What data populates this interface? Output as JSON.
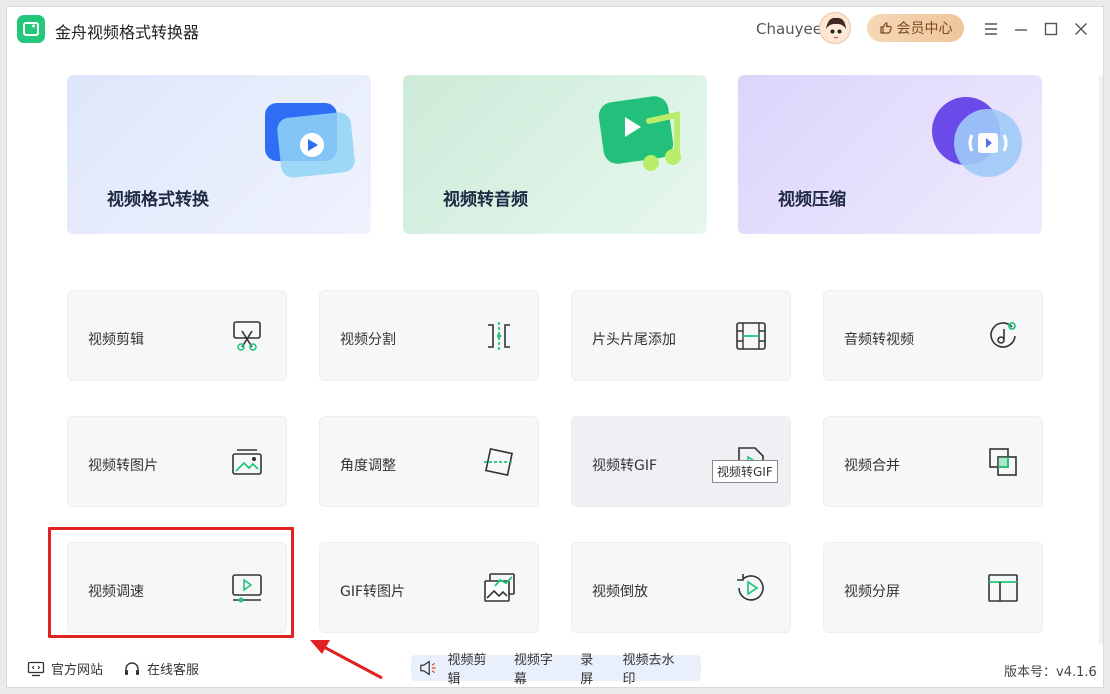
{
  "app": {
    "title": "金舟视频格式转换器"
  },
  "header": {
    "username": "Chauyee",
    "vip_label": "会员中心"
  },
  "hero": [
    {
      "label": "视频格式转换"
    },
    {
      "label": "视频转音频"
    },
    {
      "label": "视频压缩"
    }
  ],
  "tools": [
    {
      "label": "视频剪辑",
      "icon": "scissors-screen-icon"
    },
    {
      "label": "视频分割",
      "icon": "split-icon"
    },
    {
      "label": "片头片尾添加",
      "icon": "film-strip-icon"
    },
    {
      "label": "音频转视频",
      "icon": "music-note-circle-icon"
    },
    {
      "label": "视频转图片",
      "icon": "image-icon"
    },
    {
      "label": "角度调整",
      "icon": "rotate-frame-icon"
    },
    {
      "label": "视频转GIF",
      "icon": "gif-file-icon"
    },
    {
      "label": "视频合并",
      "icon": "merge-squares-icon"
    },
    {
      "label": "视频调速",
      "icon": "speed-monitor-icon"
    },
    {
      "label": "GIF转图片",
      "icon": "gallery-icon"
    },
    {
      "label": "视频倒放",
      "icon": "reverse-play-icon"
    },
    {
      "label": "视频分屏",
      "icon": "split-screen-icon"
    }
  ],
  "tooltip": "视频转GIF",
  "footer": {
    "website": "官方网站",
    "support": "在线客服",
    "quick_links": [
      "视频剪辑",
      "视频字幕",
      "录屏",
      "视频去水印"
    ],
    "version": "版本号：v4.1.6"
  },
  "colors": {
    "accent": "#22c77a",
    "highlight": "#e02222"
  }
}
